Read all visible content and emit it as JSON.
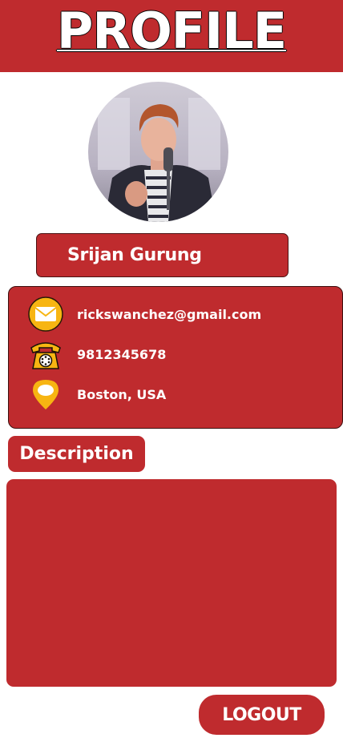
{
  "header": {
    "title": "PROFILE"
  },
  "profile": {
    "name": "Srijan Gurung",
    "avatar_icon": "profile-photo"
  },
  "contact": {
    "email": "rickswanchez@gmail.com",
    "phone": "9812345678",
    "location": "Boston, USA"
  },
  "description": {
    "label": "Description",
    "text": ""
  },
  "actions": {
    "logout_label": "LOGOUT"
  },
  "colors": {
    "accent": "#bf2b2e",
    "icon_yellow": "#f7b512",
    "background": "#ffffff"
  }
}
